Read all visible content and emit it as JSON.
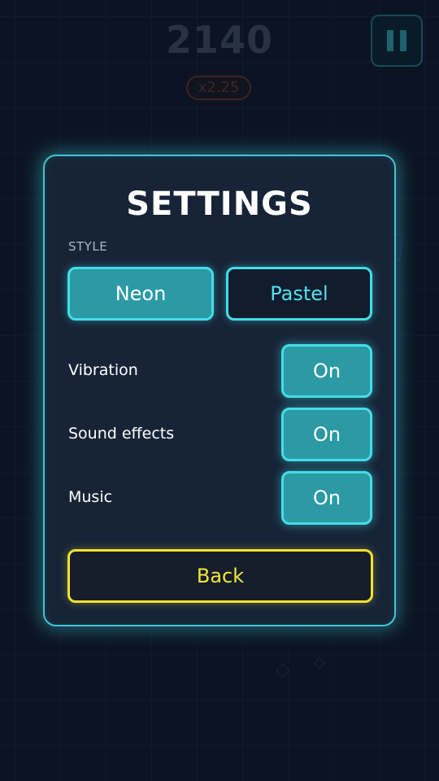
{
  "hud": {
    "score": "2140",
    "multiplier": "x2.25"
  },
  "settings": {
    "title": "SETTINGS",
    "style_label": "STYLE",
    "style_options": [
      "Neon",
      "Pastel"
    ],
    "selected_style": "Neon",
    "toggles": [
      {
        "label": "Vibration",
        "value": "On"
      },
      {
        "label": "Sound effects",
        "value": "On"
      },
      {
        "label": "Music",
        "value": "On"
      }
    ],
    "back_label": "Back"
  },
  "colors": {
    "accent": "#42dde9",
    "accent_fill": "#2b9aa5",
    "back_accent": "#f2e230",
    "panel": "#172437",
    "background": "#0e1828"
  },
  "icons": {
    "pause": "pause-icon"
  }
}
